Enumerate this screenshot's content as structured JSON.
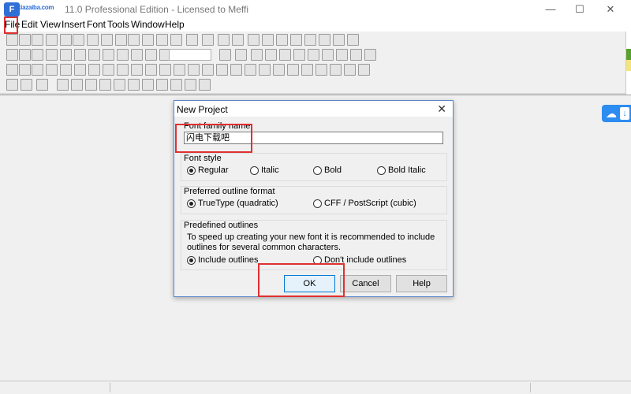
{
  "window": {
    "logo_glyph": "F",
    "logo_text": "xiazaiba.com",
    "title": "11.0 Professional Edition - Licensed to Meffi",
    "minimize": "—",
    "maximize": "☐",
    "close": "✕"
  },
  "menu": {
    "items": [
      "File",
      "Edit",
      "View",
      "Insert",
      "Font",
      "Tools",
      "Window",
      "Help"
    ]
  },
  "dialog": {
    "title": "New Project",
    "close": "✕",
    "font_family_label": "Font family name",
    "font_family_value": "闪电下载吧",
    "font_style_label": "Font style",
    "font_styles": [
      "Regular",
      "Italic",
      "Bold",
      "Bold Italic"
    ],
    "font_style_selected": "Regular",
    "outline_format_label": "Preferred outline format",
    "outline_formats": [
      "TrueType (quadratic)",
      "CFF / PostScript (cubic)"
    ],
    "outline_format_selected": "TrueType (quadratic)",
    "predefined_label": "Predefined outlines",
    "predefined_desc_line1": "To speed up creating your new font it is recommended to include",
    "predefined_desc_line2": "outlines for several common characters.",
    "predefined_options": [
      "Include outlines",
      "Don't include outlines"
    ],
    "predefined_selected": "Include outlines",
    "ok": "OK",
    "cancel": "Cancel",
    "help": "Help"
  },
  "colors": {
    "highlight_box": "#e03030",
    "accent": "#0078d7",
    "side_widget": "#2d8cf0"
  },
  "icons": [
    "app-logo-icon",
    "cloud-icon",
    "download-arrow-icon"
  ]
}
